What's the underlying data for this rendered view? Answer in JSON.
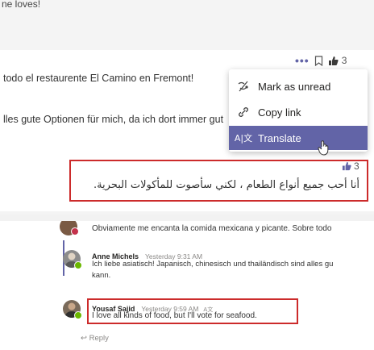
{
  "top": {
    "previous_message": "ne loves!",
    "message1": "todo el restaurente El Camino en Fremont!",
    "message2": "lles gute Optionen für mich, da ich dort immer gut",
    "actions": {
      "more": "•••",
      "like_count": "3"
    },
    "menu": [
      {
        "icon": "mark-unread-icon",
        "label": "Mark as unread"
      },
      {
        "icon": "link-icon",
        "label": "Copy link"
      },
      {
        "icon": "translate-icon",
        "label": "Translate"
      }
    ],
    "reaction_count": "3",
    "arabic_message": "أنا أحب جميع أنواع الطعام ، لكني سأصوت للمأكولات البحرية."
  },
  "bottom": {
    "msg1": "Obviamente me encanta la comida mexicana y picante. Sobre todo",
    "anne": {
      "name": "Anne Michels",
      "time": "Yesterday 9:31 AM",
      "line1": "Ich liebe asiatisch! Japanisch, chinesisch und thailändisch sind alles gu",
      "line2": "kann."
    },
    "yousaf": {
      "name": "Yousaf Sajid",
      "time": "Yesterday 9:59 AM",
      "translated_badge": "A文",
      "text": "I love all kinds of food, but I'll vote for seafood."
    },
    "reply": "Reply",
    "reply_icon": "↩"
  },
  "colors": {
    "accent": "#6264a7",
    "highlight_border": "#cc2b2b"
  }
}
